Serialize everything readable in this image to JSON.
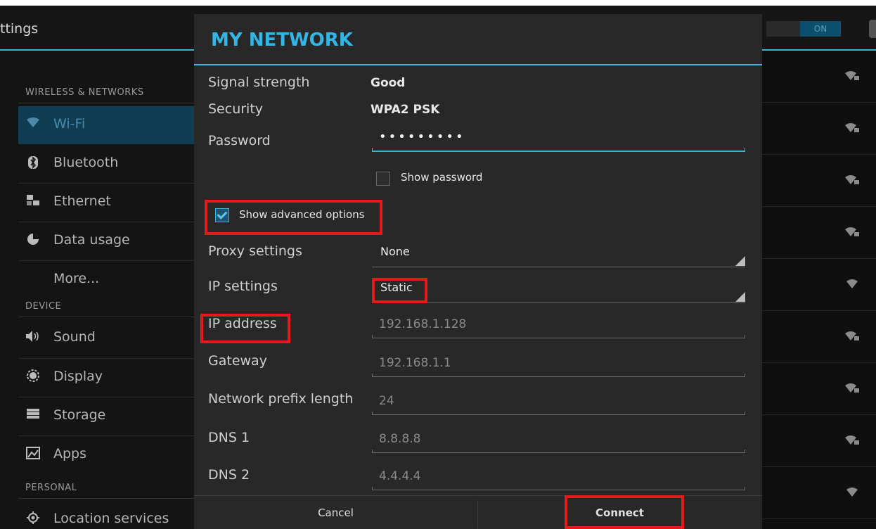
{
  "actionbar": {
    "title": "ttings",
    "toggle_label": "ON"
  },
  "sidebar": {
    "sections": {
      "wireless": "WIRELESS & NETWORKS",
      "device": "DEVICE",
      "personal": "PERSONAL"
    },
    "items": [
      {
        "label": "Wi-Fi",
        "icon": "wifi-icon"
      },
      {
        "label": "Bluetooth",
        "icon": "bluetooth-icon"
      },
      {
        "label": "Ethernet",
        "icon": "ethernet-icon"
      },
      {
        "label": "Data usage",
        "icon": "data-usage-icon"
      },
      {
        "label": "More...",
        "icon": ""
      },
      {
        "label": "Sound",
        "icon": "sound-icon"
      },
      {
        "label": "Display",
        "icon": "display-icon"
      },
      {
        "label": "Storage",
        "icon": "storage-icon"
      },
      {
        "label": "Apps",
        "icon": "apps-icon"
      },
      {
        "label": "Location services",
        "icon": "location-icon"
      }
    ]
  },
  "dialog": {
    "title": "MY NETWORK",
    "signal_label": "Signal strength",
    "signal_value": "Good",
    "security_label": "Security",
    "security_value": "WPA2 PSK",
    "password_label": "Password",
    "password_value": "•••••••••",
    "show_password": {
      "label": "Show password",
      "checked": false
    },
    "show_advanced": {
      "label": "Show advanced options",
      "checked": true
    },
    "proxy_label": "Proxy settings",
    "proxy_value": "None",
    "ip_settings_label": "IP settings",
    "ip_settings_value": "Static",
    "ip_address_label": "IP address",
    "ip_address_value": "192.168.1.128",
    "gateway_label": "Gateway",
    "gateway_value": "192.168.1.1",
    "prefix_label": "Network prefix length",
    "prefix_value": "24",
    "dns1_label": "DNS 1",
    "dns1_value": "8.8.8.8",
    "dns2_label": "DNS 2",
    "dns2_value": "4.4.4.4",
    "cancel_label": "Cancel",
    "connect_label": "Connect"
  },
  "colors": {
    "accent": "#33b5e5",
    "highlight": "#e41b1b"
  }
}
